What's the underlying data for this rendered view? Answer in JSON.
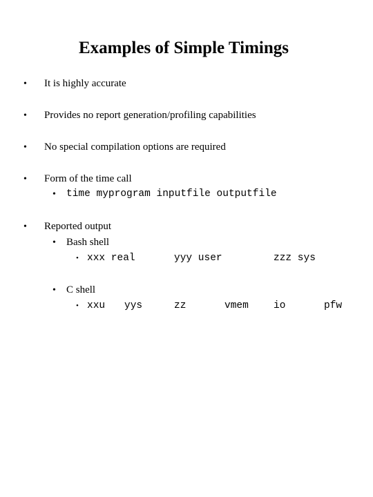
{
  "slide": {
    "title": "Examples of Simple Timings",
    "bullets": [
      {
        "text": "It is highly accurate"
      },
      {
        "text": "Provides no report generation/profiling capabilities"
      },
      {
        "text": "No special compilation options are required"
      },
      {
        "text": "Form of the time call",
        "sub": [
          "time myprogram inputfile outputfile"
        ]
      },
      {
        "text": "Reported output",
        "groups": [
          {
            "label": "Bash shell",
            "fields": [
              "xxx real",
              "yyy user",
              "zzz sys"
            ]
          },
          {
            "label": "C shell",
            "fields": [
              "xxu",
              "yys",
              "zz",
              "vmem",
              "io",
              "pfw"
            ]
          }
        ]
      }
    ],
    "bullet_glyph": "•"
  }
}
